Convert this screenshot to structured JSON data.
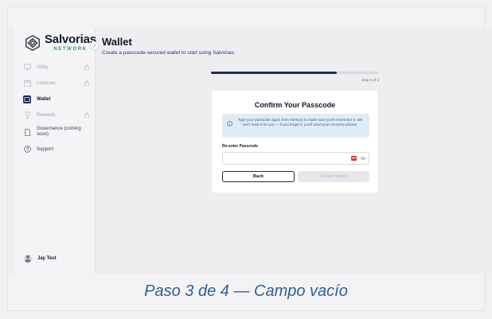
{
  "brand": {
    "name": "Salvorias",
    "sub": "NETWORK",
    "accent": "#2f9b56"
  },
  "sidebar": {
    "items": [
      {
        "label": "Utility",
        "icon": "monitor-icon",
        "locked": true
      },
      {
        "label": "Licenses",
        "icon": "calendar-icon",
        "locked": true
      },
      {
        "label": "Wallet",
        "icon": "wallet-icon",
        "active": true
      },
      {
        "label": "Rewards",
        "icon": "trophy-icon",
        "locked": true
      },
      {
        "label": "Governance (coming soon)",
        "icon": "document-icon"
      },
      {
        "label": "Support",
        "icon": "help-circle-icon"
      }
    ],
    "user": {
      "name": "Jay Test"
    }
  },
  "page": {
    "title": "Wallet",
    "subtitle": "Create a passcode-secured wallet to start using Salvorias."
  },
  "wizard": {
    "progress": 0.75,
    "step_text": "Step 3 of 4",
    "card_title": "Confirm Your Passcode",
    "info_text": "Type your passcode again from memory to make sure you'll remember it. We can't reset it for you — if you forget it, you'll need your recovery phrase.",
    "field_label": "Re-enter Passcode",
    "field_value": "",
    "field_placeholder": "",
    "back_label": "Back",
    "create_label": "Create Wallet"
  },
  "caption": "Paso 3 de 4 — Campo vacío"
}
